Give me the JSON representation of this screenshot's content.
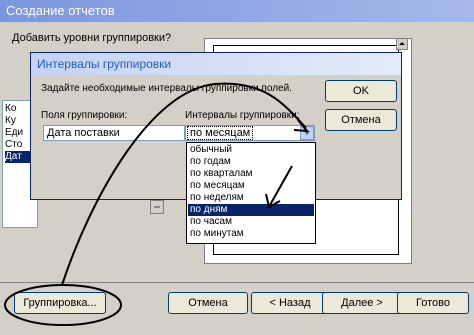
{
  "window": {
    "title": "Создание отчетов",
    "prompt": "Добавить уровни группировки?",
    "left_list_items": [
      "Ко",
      "Ку",
      "Еди",
      "Сто",
      "Дат"
    ],
    "left_list_selected_index": 4
  },
  "dialog": {
    "title": "Интервалы группировки",
    "instruction": "Задайте необходимые интервалы группировки полей.",
    "col_fields_label": "Поля группировки:",
    "col_intervals_label": "Интервалы группировки:",
    "field_value": "Дата поставки",
    "interval_value": "по месяцам",
    "ok_label": "OK",
    "cancel_label": "Отмена",
    "dropdown_options": [
      "обычный",
      "по годам",
      "по кварталам",
      "по месяцам",
      "по неделям",
      "по дням",
      "по часам",
      "по минутам"
    ],
    "dropdown_selected_index": 5
  },
  "footer": {
    "grouping_label": "Группировка...",
    "cancel_label": "Отмена",
    "back_label": "< Назад",
    "next_label": "Далее >",
    "finish_label": "Готово"
  },
  "colors": {
    "titlebar": "#7a96df",
    "selection": "#0a246a",
    "annotation": "#000000"
  },
  "icons": {
    "dropdown_arrow": "chevron-down-icon",
    "scroll_arrow": "scroll-up-icon",
    "move_arrow": "move-arrow-icon"
  }
}
